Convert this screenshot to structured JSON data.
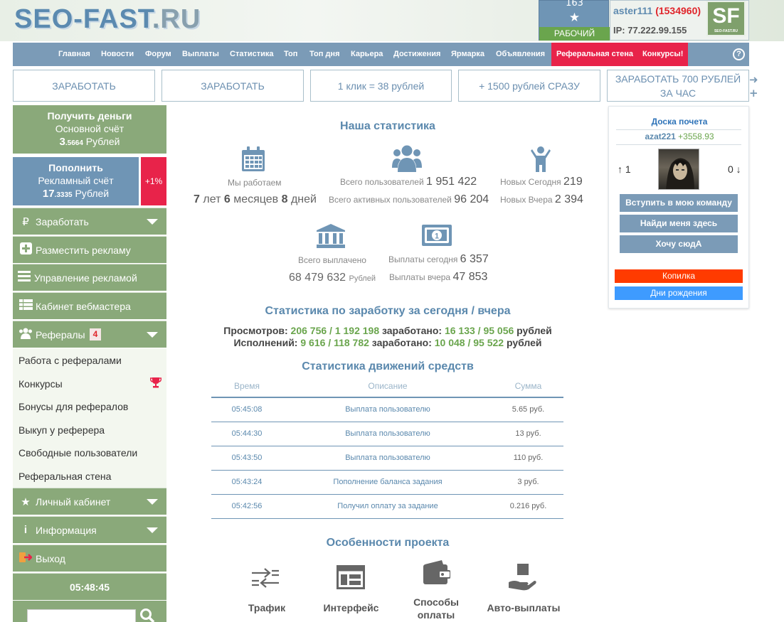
{
  "header": {
    "logo_main": "SEO-FAST",
    "logo_dot": ".",
    "logo_tld": "RU",
    "rank": {
      "number": "163",
      "label": "РАБОЧИЙ"
    },
    "user": {
      "name": "aster111",
      "id": "(1534960)",
      "ip": "IP: 77.222.99.155"
    },
    "sf_logo": "SF",
    "sf_logo_sub": "SEO-FAST.RU"
  },
  "nav": {
    "items": [
      "Главная",
      "Новости",
      "Форум",
      "Выплаты",
      "Статистика",
      "Топ",
      "Топ дня",
      "Карьера",
      "Достижения",
      "Ярмарка",
      "Объявления"
    ],
    "red_items": [
      "Реферальная стена",
      "Конкурсы!"
    ],
    "help": "?"
  },
  "banners": [
    "ЗАРАБОТАТЬ",
    "ЗАРАБОТАТЬ",
    "1 клик = 38 рублей",
    "+ 1500 рублей СРАЗУ",
    "ЗАРАБОТАТЬ 700 РУБЛЕЙ ЗА ЧАС"
  ],
  "sidebar": {
    "money": {
      "title": "Получить деньги",
      "account": "Основной счёт",
      "int": "3",
      "frac": ".5664",
      "cur": "Рублей"
    },
    "topup": {
      "title": "Пополнить",
      "account": "Рекламный счёт",
      "int": "17",
      "frac": ".3335",
      "cur": "Рублей"
    },
    "bonus": "+1%",
    "menu": {
      "earn": "Заработать",
      "place_ad": "Разместить рекламу",
      "manage_ad": "Управление рекламой",
      "webmaster": "Кабинет вебмастера",
      "referrals": "Рефералы",
      "referrals_count": "4",
      "cabinet": "Личный кабинет",
      "info": "Информация",
      "logout": "Выход"
    },
    "sub_items": [
      "Работа с рефералами",
      "Конкурсы",
      "Бонусы для рефералов",
      "Выкуп у реферера",
      "Свободные пользователи",
      "Реферальная стена"
    ],
    "clock": "05:48:45"
  },
  "stats": {
    "title": "Наша статистика",
    "working_label": "Мы работаем",
    "working_years": "7",
    "working_years_unit": "лет",
    "working_months": "6",
    "working_months_unit": "месяцев",
    "working_days": "8",
    "working_days_unit": "дней",
    "total_users_label": "Всего пользователей",
    "total_users": "1 951 422",
    "active_users_label": "Всего активных пользователей",
    "active_users": "96 204",
    "new_today_label": "Новых Сегодня",
    "new_today": "219",
    "new_yesterday_label": "Новых Вчера",
    "new_yesterday": "2 394",
    "paid_total_label": "Всего выплачено",
    "paid_total": "68 479 632",
    "paid_total_unit": "Рублей",
    "paid_today_label": "Выплаты сегодня",
    "paid_today": "6 357",
    "paid_yesterday_label": "Выплаты вчера",
    "paid_yesterday": "47 853"
  },
  "earnings": {
    "title": "Статистика по заработку за сегодня / вчера",
    "views_label": "Просмотров:",
    "views": "206 756 / 1 192 198",
    "views_earned_label": "заработано:",
    "views_earned": "16 133 / 95 056",
    "views_unit": "рублей",
    "tasks_label": "Исполнений:",
    "tasks": "9 616 / 118 782",
    "tasks_earned_label": "заработано:",
    "tasks_earned": "10 048 / 95 522",
    "tasks_unit": "рублей"
  },
  "movements": {
    "title": "Статистика движений средств",
    "headers": [
      "Время",
      "Описание",
      "Сумма"
    ],
    "rows": [
      [
        "05:45:08",
        "Выплата пользователю",
        "5.65 руб."
      ],
      [
        "05:44:30",
        "Выплата пользователю",
        "13 руб."
      ],
      [
        "05:43:50",
        "Выплата пользователю",
        "110 руб."
      ],
      [
        "05:43:24",
        "Пополнение баланса задания",
        "3 руб."
      ],
      [
        "05:42:56",
        "Получил оплату за задание",
        "0.216 руб."
      ]
    ]
  },
  "features": {
    "title": "Особенности проекта",
    "items": [
      "Трафик",
      "Интерфейс",
      "Способы оплаты",
      "Авто-выплаты"
    ]
  },
  "honor": {
    "title": "Доска почета",
    "user": "azat221",
    "points": "+3558.93",
    "up": "↑ 1",
    "down": "0 ↓",
    "buttons": [
      "Вступить в мою команду",
      "Найди меня здесь",
      "Хочу сюдА"
    ],
    "piggy": "Копилка",
    "birthdays": "Дни рождения"
  },
  "colors": {
    "steel": "#7b9bb7",
    "green": "#8aa97a",
    "red": "#e8234a",
    "orange": "#ff3b00",
    "blue": "#3e9bff"
  }
}
